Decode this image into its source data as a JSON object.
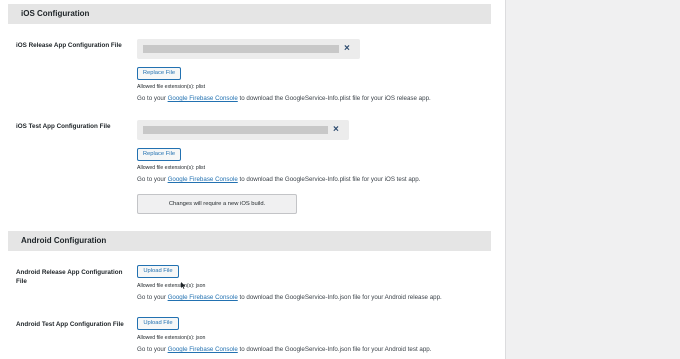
{
  "ios": {
    "section_title": "iOS Configuration",
    "release": {
      "label": "iOS Release App Configuration File",
      "button": "Replace File",
      "remove_symbol": "×",
      "allowed": "Allowed file extension(s): plist",
      "desc_prefix": "Go to your ",
      "desc_link": "Google Firebase Console",
      "desc_suffix": " to download the GoogleService-Info.plist file for your iOS release app."
    },
    "test": {
      "label": "iOS Test App Configuration File",
      "button": "Replace File",
      "remove_symbol": "×",
      "allowed": "Allowed file extension(s): plist",
      "desc_prefix": "Go to your ",
      "desc_link": "Google Firebase Console",
      "desc_suffix": " to download the GoogleService-Info.plist file for your iOS test app."
    },
    "notice": "Changes will require a new iOS build."
  },
  "android": {
    "section_title": "Android Configuration",
    "release": {
      "label": "Android Release App Configuration File",
      "button": "Upload File",
      "allowed": "Allowed file extension(s): json",
      "desc_prefix": "Go to your ",
      "desc_link": "Google Firebase Console",
      "desc_suffix": " to download the GoogleService-Info.json file for your Android release app."
    },
    "test": {
      "label": "Android Test App Configuration File",
      "button": "Upload File",
      "allowed": "Allowed file extension(s): json",
      "desc_prefix": "Go to your ",
      "desc_link": "Google Firebase Console",
      "desc_suffix": " to download the GoogleService-Info.json file for your Android test app."
    }
  },
  "icons": {
    "remove": "close-icon",
    "cursor": "pointer-cursor-icon"
  },
  "colors": {
    "accent": "#2271b1",
    "section_bg": "#e5e5e5",
    "page_bg": "#f0f0f1"
  }
}
